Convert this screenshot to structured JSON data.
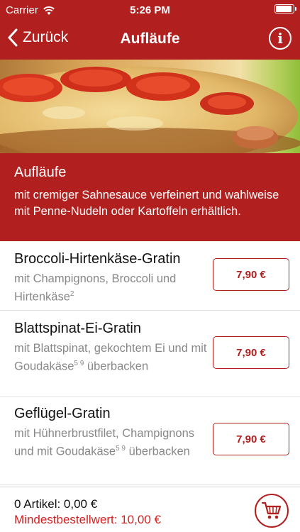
{
  "statusbar": {
    "carrier": "Carrier",
    "time": "5:26 PM"
  },
  "nav": {
    "back_label": "Zurück",
    "title": "Aufläufe",
    "info_label": "i"
  },
  "category": {
    "title": "Aufläufe",
    "description": "mit cremiger Sahnesauce verfeinert und wahlweise mit Penne-Nudeln oder Kartoffeln erhältlich."
  },
  "items": [
    {
      "name": "Broccoli-Hirtenkäse-Gratin",
      "desc_text": "mit Champignons, Broccoli und Hirtenkäse",
      "desc_sup": "2",
      "desc_after": "",
      "price": "7,90 €"
    },
    {
      "name": "Blattspinat-Ei-Gratin",
      "desc_text": "mit Blattspinat, gekochtem Ei und mit Goudakäse",
      "desc_sup": "5 9",
      "desc_after": " überbacken",
      "price": "7,90 €"
    },
    {
      "name": "Geflügel-Gratin",
      "desc_text": "mit Hühnerbrustfilet, Champignons und mit Goudakäse",
      "desc_sup": "5 9",
      "desc_after": " überbacken",
      "price": "7,90 €"
    }
  ],
  "footer": {
    "count_text": "0 Artikel: 0,00 €",
    "min_order_text": "Mindestbestellwert: 10,00 €"
  },
  "colors": {
    "brand_red": "#b21f1f",
    "warning_red": "#d31f1f",
    "muted_text": "#888888"
  },
  "icons": [
    "wifi-icon",
    "battery-icon",
    "chevron-left-icon",
    "info-icon",
    "cart-icon"
  ]
}
